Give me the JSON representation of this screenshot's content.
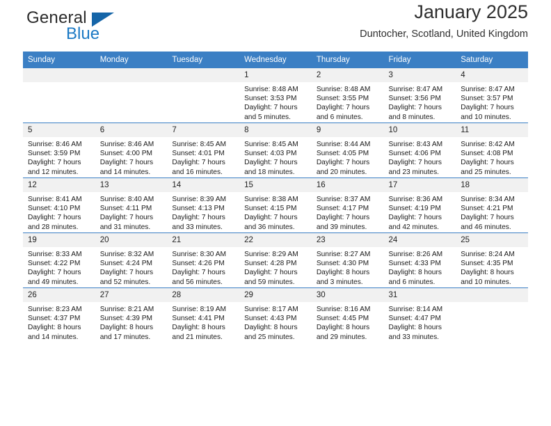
{
  "logo": {
    "word1": "General",
    "word2": "Blue",
    "triangle_color": "#1565a8",
    "blue_color": "#1b79c4"
  },
  "header": {
    "title": "January 2025",
    "subtitle": "Duntocher, Scotland, United Kingdom"
  },
  "theme": {
    "header_bg": "#3b7fc4",
    "daynum_bg": "#f1f1f1",
    "rule_color": "#3b7fc4"
  },
  "calendar": {
    "weekday_headers": [
      "Sunday",
      "Monday",
      "Tuesday",
      "Wednesday",
      "Thursday",
      "Friday",
      "Saturday"
    ],
    "weeks": [
      [
        {
          "day": "",
          "blank": true,
          "sunrise": "",
          "sunset": "",
          "daylight_line1": "",
          "daylight_line2": ""
        },
        {
          "day": "",
          "blank": true,
          "sunrise": "",
          "sunset": "",
          "daylight_line1": "",
          "daylight_line2": ""
        },
        {
          "day": "",
          "blank": true,
          "sunrise": "",
          "sunset": "",
          "daylight_line1": "",
          "daylight_line2": ""
        },
        {
          "day": "1",
          "blank": false,
          "sunrise": "Sunrise: 8:48 AM",
          "sunset": "Sunset: 3:53 PM",
          "daylight_line1": "Daylight: 7 hours",
          "daylight_line2": "and 5 minutes."
        },
        {
          "day": "2",
          "blank": false,
          "sunrise": "Sunrise: 8:48 AM",
          "sunset": "Sunset: 3:55 PM",
          "daylight_line1": "Daylight: 7 hours",
          "daylight_line2": "and 6 minutes."
        },
        {
          "day": "3",
          "blank": false,
          "sunrise": "Sunrise: 8:47 AM",
          "sunset": "Sunset: 3:56 PM",
          "daylight_line1": "Daylight: 7 hours",
          "daylight_line2": "and 8 minutes."
        },
        {
          "day": "4",
          "blank": false,
          "sunrise": "Sunrise: 8:47 AM",
          "sunset": "Sunset: 3:57 PM",
          "daylight_line1": "Daylight: 7 hours",
          "daylight_line2": "and 10 minutes."
        }
      ],
      [
        {
          "day": "5",
          "blank": false,
          "sunrise": "Sunrise: 8:46 AM",
          "sunset": "Sunset: 3:59 PM",
          "daylight_line1": "Daylight: 7 hours",
          "daylight_line2": "and 12 minutes."
        },
        {
          "day": "6",
          "blank": false,
          "sunrise": "Sunrise: 8:46 AM",
          "sunset": "Sunset: 4:00 PM",
          "daylight_line1": "Daylight: 7 hours",
          "daylight_line2": "and 14 minutes."
        },
        {
          "day": "7",
          "blank": false,
          "sunrise": "Sunrise: 8:45 AM",
          "sunset": "Sunset: 4:01 PM",
          "daylight_line1": "Daylight: 7 hours",
          "daylight_line2": "and 16 minutes."
        },
        {
          "day": "8",
          "blank": false,
          "sunrise": "Sunrise: 8:45 AM",
          "sunset": "Sunset: 4:03 PM",
          "daylight_line1": "Daylight: 7 hours",
          "daylight_line2": "and 18 minutes."
        },
        {
          "day": "9",
          "blank": false,
          "sunrise": "Sunrise: 8:44 AM",
          "sunset": "Sunset: 4:05 PM",
          "daylight_line1": "Daylight: 7 hours",
          "daylight_line2": "and 20 minutes."
        },
        {
          "day": "10",
          "blank": false,
          "sunrise": "Sunrise: 8:43 AM",
          "sunset": "Sunset: 4:06 PM",
          "daylight_line1": "Daylight: 7 hours",
          "daylight_line2": "and 23 minutes."
        },
        {
          "day": "11",
          "blank": false,
          "sunrise": "Sunrise: 8:42 AM",
          "sunset": "Sunset: 4:08 PM",
          "daylight_line1": "Daylight: 7 hours",
          "daylight_line2": "and 25 minutes."
        }
      ],
      [
        {
          "day": "12",
          "blank": false,
          "sunrise": "Sunrise: 8:41 AM",
          "sunset": "Sunset: 4:10 PM",
          "daylight_line1": "Daylight: 7 hours",
          "daylight_line2": "and 28 minutes."
        },
        {
          "day": "13",
          "blank": false,
          "sunrise": "Sunrise: 8:40 AM",
          "sunset": "Sunset: 4:11 PM",
          "daylight_line1": "Daylight: 7 hours",
          "daylight_line2": "and 31 minutes."
        },
        {
          "day": "14",
          "blank": false,
          "sunrise": "Sunrise: 8:39 AM",
          "sunset": "Sunset: 4:13 PM",
          "daylight_line1": "Daylight: 7 hours",
          "daylight_line2": "and 33 minutes."
        },
        {
          "day": "15",
          "blank": false,
          "sunrise": "Sunrise: 8:38 AM",
          "sunset": "Sunset: 4:15 PM",
          "daylight_line1": "Daylight: 7 hours",
          "daylight_line2": "and 36 minutes."
        },
        {
          "day": "16",
          "blank": false,
          "sunrise": "Sunrise: 8:37 AM",
          "sunset": "Sunset: 4:17 PM",
          "daylight_line1": "Daylight: 7 hours",
          "daylight_line2": "and 39 minutes."
        },
        {
          "day": "17",
          "blank": false,
          "sunrise": "Sunrise: 8:36 AM",
          "sunset": "Sunset: 4:19 PM",
          "daylight_line1": "Daylight: 7 hours",
          "daylight_line2": "and 42 minutes."
        },
        {
          "day": "18",
          "blank": false,
          "sunrise": "Sunrise: 8:34 AM",
          "sunset": "Sunset: 4:21 PM",
          "daylight_line1": "Daylight: 7 hours",
          "daylight_line2": "and 46 minutes."
        }
      ],
      [
        {
          "day": "19",
          "blank": false,
          "sunrise": "Sunrise: 8:33 AM",
          "sunset": "Sunset: 4:22 PM",
          "daylight_line1": "Daylight: 7 hours",
          "daylight_line2": "and 49 minutes."
        },
        {
          "day": "20",
          "blank": false,
          "sunrise": "Sunrise: 8:32 AM",
          "sunset": "Sunset: 4:24 PM",
          "daylight_line1": "Daylight: 7 hours",
          "daylight_line2": "and 52 minutes."
        },
        {
          "day": "21",
          "blank": false,
          "sunrise": "Sunrise: 8:30 AM",
          "sunset": "Sunset: 4:26 PM",
          "daylight_line1": "Daylight: 7 hours",
          "daylight_line2": "and 56 minutes."
        },
        {
          "day": "22",
          "blank": false,
          "sunrise": "Sunrise: 8:29 AM",
          "sunset": "Sunset: 4:28 PM",
          "daylight_line1": "Daylight: 7 hours",
          "daylight_line2": "and 59 minutes."
        },
        {
          "day": "23",
          "blank": false,
          "sunrise": "Sunrise: 8:27 AM",
          "sunset": "Sunset: 4:30 PM",
          "daylight_line1": "Daylight: 8 hours",
          "daylight_line2": "and 3 minutes."
        },
        {
          "day": "24",
          "blank": false,
          "sunrise": "Sunrise: 8:26 AM",
          "sunset": "Sunset: 4:33 PM",
          "daylight_line1": "Daylight: 8 hours",
          "daylight_line2": "and 6 minutes."
        },
        {
          "day": "25",
          "blank": false,
          "sunrise": "Sunrise: 8:24 AM",
          "sunset": "Sunset: 4:35 PM",
          "daylight_line1": "Daylight: 8 hours",
          "daylight_line2": "and 10 minutes."
        }
      ],
      [
        {
          "day": "26",
          "blank": false,
          "sunrise": "Sunrise: 8:23 AM",
          "sunset": "Sunset: 4:37 PM",
          "daylight_line1": "Daylight: 8 hours",
          "daylight_line2": "and 14 minutes."
        },
        {
          "day": "27",
          "blank": false,
          "sunrise": "Sunrise: 8:21 AM",
          "sunset": "Sunset: 4:39 PM",
          "daylight_line1": "Daylight: 8 hours",
          "daylight_line2": "and 17 minutes."
        },
        {
          "day": "28",
          "blank": false,
          "sunrise": "Sunrise: 8:19 AM",
          "sunset": "Sunset: 4:41 PM",
          "daylight_line1": "Daylight: 8 hours",
          "daylight_line2": "and 21 minutes."
        },
        {
          "day": "29",
          "blank": false,
          "sunrise": "Sunrise: 8:17 AM",
          "sunset": "Sunset: 4:43 PM",
          "daylight_line1": "Daylight: 8 hours",
          "daylight_line2": "and 25 minutes."
        },
        {
          "day": "30",
          "blank": false,
          "sunrise": "Sunrise: 8:16 AM",
          "sunset": "Sunset: 4:45 PM",
          "daylight_line1": "Daylight: 8 hours",
          "daylight_line2": "and 29 minutes."
        },
        {
          "day": "31",
          "blank": false,
          "sunrise": "Sunrise: 8:14 AM",
          "sunset": "Sunset: 4:47 PM",
          "daylight_line1": "Daylight: 8 hours",
          "daylight_line2": "and 33 minutes."
        },
        {
          "day": "",
          "blank": true,
          "sunrise": "",
          "sunset": "",
          "daylight_line1": "",
          "daylight_line2": ""
        }
      ]
    ]
  }
}
